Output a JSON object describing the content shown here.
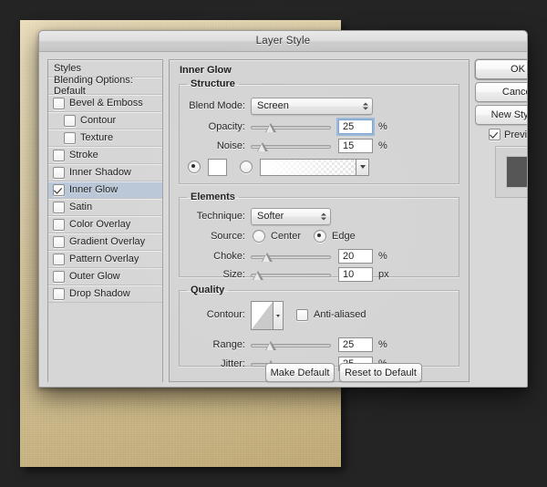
{
  "window": {
    "title": "Layer Style"
  },
  "styles_panel": {
    "header": "Styles",
    "blending_options": "Blending Options: Default",
    "items": [
      {
        "label": "Bevel & Emboss",
        "checked": false,
        "sub": false,
        "selected": false
      },
      {
        "label": "Contour",
        "checked": false,
        "sub": true,
        "selected": false
      },
      {
        "label": "Texture",
        "checked": false,
        "sub": true,
        "selected": false
      },
      {
        "label": "Stroke",
        "checked": false,
        "sub": false,
        "selected": false
      },
      {
        "label": "Inner Shadow",
        "checked": false,
        "sub": false,
        "selected": false
      },
      {
        "label": "Inner Glow",
        "checked": true,
        "sub": false,
        "selected": true
      },
      {
        "label": "Satin",
        "checked": false,
        "sub": false,
        "selected": false
      },
      {
        "label": "Color Overlay",
        "checked": false,
        "sub": false,
        "selected": false
      },
      {
        "label": "Gradient Overlay",
        "checked": false,
        "sub": false,
        "selected": false
      },
      {
        "label": "Pattern Overlay",
        "checked": false,
        "sub": false,
        "selected": false
      },
      {
        "label": "Outer Glow",
        "checked": false,
        "sub": false,
        "selected": false
      },
      {
        "label": "Drop Shadow",
        "checked": false,
        "sub": false,
        "selected": false
      }
    ]
  },
  "options": {
    "panel_title": "Inner Glow",
    "structure": {
      "legend": "Structure",
      "blend_mode_label": "Blend Mode:",
      "blend_mode_value": "Screen",
      "opacity_label": "Opacity:",
      "opacity_value": "25",
      "opacity_unit": "%",
      "opacity_pct": 25,
      "noise_label": "Noise:",
      "noise_value": "15",
      "noise_unit": "%",
      "noise_pct": 15,
      "fill_type": "color",
      "color_value": "#ffffff"
    },
    "elements": {
      "legend": "Elements",
      "technique_label": "Technique:",
      "technique_value": "Softer",
      "source_label": "Source:",
      "source_center_label": "Center",
      "source_edge_label": "Edge",
      "source_value": "Edge",
      "choke_label": "Choke:",
      "choke_value": "20",
      "choke_unit": "%",
      "choke_pct": 20,
      "size_label": "Size:",
      "size_value": "10",
      "size_unit": "px",
      "size_pct": 10
    },
    "quality": {
      "legend": "Quality",
      "contour_label": "Contour:",
      "anti_aliased_label": "Anti-aliased",
      "anti_aliased_checked": false,
      "range_label": "Range:",
      "range_value": "25",
      "range_unit": "%",
      "range_pct": 25,
      "jitter_label": "Jitter:",
      "jitter_value": "25",
      "jitter_unit": "%",
      "jitter_pct": 25
    }
  },
  "buttons": {
    "ok": "OK",
    "cancel": "Cancel",
    "new_style": "New Style...",
    "make_default": "Make Default",
    "reset_to_default": "Reset to Default"
  },
  "preview": {
    "label": "Preview",
    "checked": true,
    "swatch_color": "#565656"
  },
  "colors": {
    "desktop": "#242424",
    "canvas": "#e2cf9c",
    "dialog": "#d8d8d8",
    "selection": "#b9c7d8",
    "focus_ring": "#7aa4d6"
  }
}
